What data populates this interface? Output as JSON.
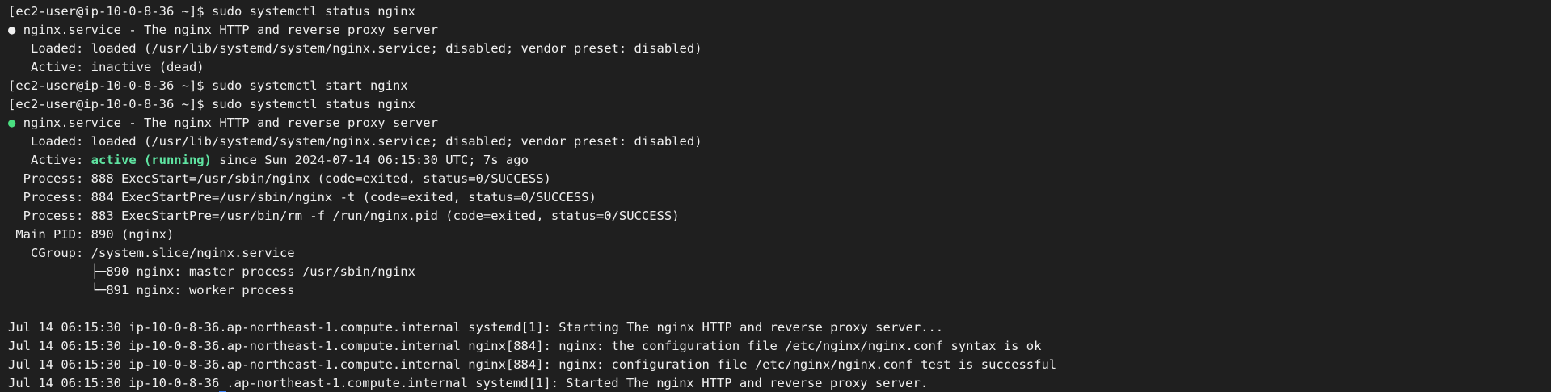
{
  "terminal": {
    "prompt": "[ec2-user@ip-10-0-8-36 ~]$",
    "commands": {
      "status1": "sudo systemctl status nginx",
      "start": "sudo systemctl start nginx",
      "status2": "sudo systemctl status nginx"
    },
    "status1": {
      "bullet": "●",
      "unit": "nginx.service - The nginx HTTP and reverse proxy server",
      "loaded": "   Loaded: loaded (/usr/lib/systemd/system/nginx.service; disabled; vendor preset: disabled)",
      "active": "   Active: inactive (dead)"
    },
    "status2": {
      "bullet": "●",
      "unit": "nginx.service - The nginx HTTP and reverse proxy server",
      "loaded": "   Loaded: loaded (/usr/lib/systemd/system/nginx.service; disabled; vendor preset: disabled)",
      "active_label": "   Active: ",
      "active_state": "active (running)",
      "active_since": " since Sun 2024-07-14 06:15:30 UTC; 7s ago",
      "process1": "  Process: 888 ExecStart=/usr/sbin/nginx (code=exited, status=0/SUCCESS)",
      "process2": "  Process: 884 ExecStartPre=/usr/sbin/nginx -t (code=exited, status=0/SUCCESS)",
      "process3": "  Process: 883 ExecStartPre=/usr/bin/rm -f /run/nginx.pid (code=exited, status=0/SUCCESS)",
      "main_pid": " Main PID: 890 (nginx)",
      "cgroup": "   CGroup: /system.slice/nginx.service",
      "cgroup_child1": "           ├─890 nginx: master process /usr/sbin/nginx",
      "cgroup_child2": "           └─891 nginx: worker process"
    },
    "logs": [
      "Jul 14 06:15:30 ip-10-0-8-36.ap-northeast-1.compute.internal systemd[1]: Starting The nginx HTTP and reverse proxy server...",
      "Jul 14 06:15:30 ip-10-0-8-36.ap-northeast-1.compute.internal nginx[884]: nginx: the configuration file /etc/nginx/nginx.conf syntax is ok",
      "Jul 14 06:15:30 ip-10-0-8-36.ap-northeast-1.compute.internal nginx[884]: nginx: configuration file /etc/nginx/nginx.conf test is successful"
    ],
    "last_log_before_cursor": "Jul 14 06:15:30 ip-10-0-8-36",
    "last_log_after_cursor": ".ap-northeast-1.compute.internal systemd[1]: Started The nginx HTTP and reverse proxy server.",
    "colors": {
      "background": "#1f1f1f",
      "foreground": "#f0f0f0",
      "active_green": "#5fe3a1",
      "bullet_green": "#4ade80",
      "cursor_blue": "#3b82f6"
    }
  }
}
